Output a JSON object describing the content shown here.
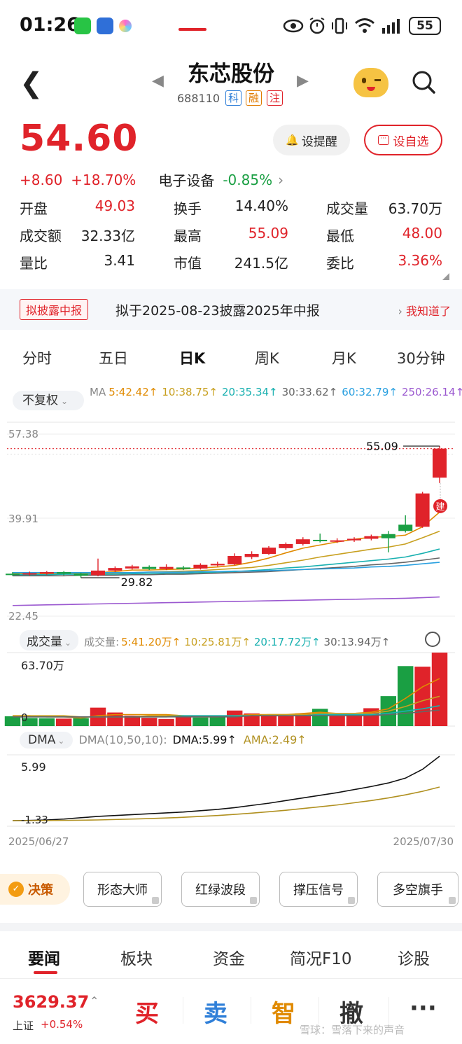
{
  "status": {
    "time": "01:26",
    "battery": "55"
  },
  "header": {
    "name": "东芯股份",
    "code": "688110",
    "tags": [
      {
        "label": "科",
        "color": "#2f7fd8"
      },
      {
        "label": "融",
        "color": "#e07b00"
      },
      {
        "label": "注",
        "color": "#e0232a"
      }
    ]
  },
  "quote": {
    "price": "54.60",
    "change": "+8.60",
    "change_pct": "+18.70%",
    "sector": "电子设备",
    "sector_pct": "-0.85%",
    "remind_label": "设提醒",
    "watch_label": "设自选",
    "stats": [
      {
        "label": "开盘",
        "value": "49.03",
        "color": "red"
      },
      {
        "label": "换手",
        "value": "14.40%",
        "color": "black"
      },
      {
        "label": "成交量",
        "value": "63.70万",
        "color": "black"
      },
      {
        "label": "成交额",
        "value": "32.33亿",
        "color": "black"
      },
      {
        "label": "最高",
        "value": "55.09",
        "color": "red"
      },
      {
        "label": "最低",
        "value": "48.00",
        "color": "red"
      },
      {
        "label": "量比",
        "value": "3.41",
        "color": "black"
      },
      {
        "label": "市值",
        "value": "241.5亿",
        "color": "black"
      },
      {
        "label": "委比",
        "value": "3.36%",
        "color": "red"
      }
    ]
  },
  "disclosure": {
    "tag": "拟披露中报",
    "text": "拟于2025-08-23披露2025年中报",
    "action": "我知道了"
  },
  "period_tabs": [
    "分时",
    "五日",
    "日K",
    "周K",
    "月K",
    "30分钟"
  ],
  "active_period": "日K",
  "ma": {
    "adjust": "不复权",
    "prefix": "MA",
    "items": [
      {
        "label": "5:42.42↑",
        "color": "#e08a00"
      },
      {
        "label": "10:38.75↑",
        "color": "#c8a020"
      },
      {
        "label": "20:35.34↑",
        "color": "#18b0b0"
      },
      {
        "label": "30:33.62↑",
        "color": "#666666"
      },
      {
        "label": "60:32.79↑",
        "color": "#2aa0e0"
      },
      {
        "label": "250:26.14↑",
        "color": "#9b59d0"
      }
    ]
  },
  "vol_legend": {
    "button": "成交量",
    "prefix": "成交量:",
    "items": [
      {
        "label": "5:41.20万↑",
        "color": "#e08a00"
      },
      {
        "label": "10:25.81万↑",
        "color": "#c8a020"
      },
      {
        "label": "20:17.72万↑",
        "color": "#18b0b0"
      },
      {
        "label": "30:13.94万↑",
        "color": "#666666"
      }
    ]
  },
  "dma_legend": {
    "button": "DMA",
    "params": "DMA(10,50,10):",
    "dma": "DMA:5.99↑",
    "ama": "AMA:2.49↑"
  },
  "chart_data": {
    "type": "candlestick",
    "price_axis": {
      "top": "57.38",
      "mid": "39.91",
      "bottom": "22.45",
      "min": 22.45,
      "max": 57.38
    },
    "high_label": "55.09",
    "low_label": "29.82",
    "build_label": "建",
    "start_date": "2025/06/27",
    "end_date": "2025/07/30",
    "candles": [
      {
        "o": 30.6,
        "c": 30.4,
        "h": 30.9,
        "l": 30.2
      },
      {
        "o": 30.5,
        "c": 30.7,
        "h": 31.0,
        "l": 30.3
      },
      {
        "o": 30.6,
        "c": 30.9,
        "h": 31.1,
        "l": 30.4
      },
      {
        "o": 30.9,
        "c": 30.6,
        "h": 31.1,
        "l": 30.3
      },
      {
        "o": 30.6,
        "c": 30.2,
        "h": 30.8,
        "l": 29.82
      },
      {
        "o": 30.3,
        "c": 31.2,
        "h": 33.5,
        "l": 30.1
      },
      {
        "o": 31.2,
        "c": 31.7,
        "h": 32.0,
        "l": 30.9
      },
      {
        "o": 31.6,
        "c": 32.0,
        "h": 32.3,
        "l": 31.4
      },
      {
        "o": 31.9,
        "c": 31.5,
        "h": 32.2,
        "l": 31.3
      },
      {
        "o": 31.5,
        "c": 31.9,
        "h": 32.4,
        "l": 31.3
      },
      {
        "o": 31.8,
        "c": 31.5,
        "h": 32.1,
        "l": 31.3
      },
      {
        "o": 31.6,
        "c": 32.3,
        "h": 32.6,
        "l": 31.4
      },
      {
        "o": 32.2,
        "c": 32.5,
        "h": 32.9,
        "l": 32.0
      },
      {
        "o": 32.4,
        "c": 34.0,
        "h": 34.5,
        "l": 32.2
      },
      {
        "o": 33.8,
        "c": 34.4,
        "h": 34.9,
        "l": 33.4
      },
      {
        "o": 34.4,
        "c": 35.6,
        "h": 35.9,
        "l": 34.2
      },
      {
        "o": 35.5,
        "c": 36.3,
        "h": 36.6,
        "l": 35.2
      },
      {
        "o": 36.3,
        "c": 37.2,
        "h": 37.6,
        "l": 36.0
      },
      {
        "o": 37.1,
        "c": 36.9,
        "h": 38.3,
        "l": 36.6
      },
      {
        "o": 36.8,
        "c": 37.0,
        "h": 37.4,
        "l": 36.5
      },
      {
        "o": 37.0,
        "c": 37.3,
        "h": 37.6,
        "l": 36.7
      },
      {
        "o": 37.3,
        "c": 37.8,
        "h": 38.1,
        "l": 37.0
      },
      {
        "o": 38.2,
        "c": 37.4,
        "h": 38.8,
        "l": 34.7
      },
      {
        "o": 40.0,
        "c": 38.8,
        "h": 41.8,
        "l": 38.5
      },
      {
        "o": 39.6,
        "c": 46.0,
        "h": 46.3,
        "l": 39.4
      },
      {
        "o": 49.03,
        "c": 54.6,
        "h": 55.09,
        "l": 48.0
      }
    ],
    "ma_lines": [
      {
        "name": "MA5",
        "color": "#e08a00",
        "values": [
          30.7,
          30.6,
          30.6,
          30.6,
          30.6,
          30.8,
          31.0,
          31.3,
          31.3,
          31.4,
          31.5,
          31.7,
          31.9,
          32.2,
          32.8,
          33.6,
          34.6,
          35.5,
          36.1,
          36.7,
          37.2,
          37.6,
          37.7,
          38.0,
          39.6,
          42.42
        ]
      },
      {
        "name": "MA10",
        "color": "#c8a020",
        "values": [
          30.6,
          30.6,
          30.6,
          30.6,
          30.6,
          30.6,
          30.7,
          30.8,
          30.9,
          31.0,
          31.1,
          31.2,
          31.4,
          31.6,
          31.8,
          32.2,
          32.7,
          33.2,
          33.8,
          34.3,
          34.8,
          35.3,
          35.7,
          36.3,
          37.5,
          38.75
        ]
      },
      {
        "name": "MA20",
        "color": "#18b0b0",
        "values": [
          30.4,
          30.4,
          30.4,
          30.5,
          30.5,
          30.5,
          30.5,
          30.6,
          30.6,
          30.7,
          30.7,
          30.8,
          30.9,
          31.0,
          31.2,
          31.4,
          31.7,
          31.9,
          32.2,
          32.5,
          32.8,
          33.1,
          33.4,
          33.8,
          34.5,
          35.34
        ]
      },
      {
        "name": "MA30",
        "color": "#666666",
        "values": [
          30.2,
          30.2,
          30.2,
          30.2,
          30.3,
          30.3,
          30.3,
          30.4,
          30.4,
          30.5,
          30.5,
          30.6,
          30.7,
          30.8,
          30.9,
          31.0,
          31.2,
          31.4,
          31.6,
          31.8,
          32.0,
          32.3,
          32.5,
          32.8,
          33.2,
          33.62
        ]
      },
      {
        "name": "MA60",
        "color": "#2aa0e0",
        "values": [
          30.8,
          30.8,
          30.8,
          30.8,
          30.8,
          30.8,
          30.8,
          30.8,
          30.9,
          30.9,
          30.9,
          31.0,
          31.0,
          31.1,
          31.1,
          31.2,
          31.3,
          31.4,
          31.5,
          31.6,
          31.7,
          31.9,
          32.0,
          32.2,
          32.5,
          32.79
        ]
      },
      {
        "name": "MA250",
        "color": "#9b59d0",
        "values": [
          24.5,
          24.56,
          24.62,
          24.68,
          24.74,
          24.8,
          24.86,
          24.92,
          24.98,
          25.04,
          25.1,
          25.16,
          25.22,
          25.28,
          25.34,
          25.4,
          25.46,
          25.52,
          25.58,
          25.64,
          25.7,
          25.76,
          25.82,
          25.88,
          26.0,
          26.14
        ]
      }
    ],
    "volume": {
      "max_label": "63.70万",
      "zero_label": "0",
      "values": [
        8.5,
        7.0,
        6.8,
        6.5,
        6.9,
        16.0,
        11.8,
        9.0,
        7.2,
        6.2,
        7.8,
        7.5,
        8.0,
        13.5,
        11.0,
        9.5,
        8.5,
        11.0,
        15.0,
        9.5,
        10.0,
        15.5,
        26.0,
        52.0,
        51.5,
        63.7
      ],
      "up": [
        false,
        false,
        false,
        true,
        false,
        true,
        true,
        true,
        true,
        true,
        true,
        false,
        false,
        true,
        true,
        true,
        true,
        true,
        false,
        true,
        true,
        true,
        false,
        false,
        true,
        true
      ],
      "ma_lines": [
        {
          "color": "#e08a00",
          "values": [
            9,
            9,
            8,
            8,
            7,
            9,
            10,
            10,
            10,
            10,
            9,
            8,
            8,
            9,
            10,
            10,
            10,
            11,
            12,
            11,
            11,
            12,
            15,
            24,
            34,
            41.2
          ]
        },
        {
          "color": "#c8a020",
          "values": [
            9,
            9,
            9,
            9,
            8,
            8,
            8,
            8,
            9,
            9,
            9,
            9,
            9,
            9,
            9,
            10,
            10,
            10,
            11,
            11,
            11,
            11,
            13,
            17,
            22,
            25.81
          ]
        },
        {
          "color": "#18b0b0",
          "values": [
            8,
            8,
            8,
            8,
            8,
            8,
            8,
            8,
            8,
            8,
            9,
            9,
            9,
            9,
            9,
            9,
            9,
            9,
            10,
            10,
            10,
            10,
            11,
            13,
            15,
            17.72
          ]
        },
        {
          "color": "#666666",
          "values": [
            8,
            8,
            8,
            8,
            8,
            8,
            8,
            8,
            8,
            8,
            8,
            8,
            8,
            8,
            9,
            9,
            9,
            9,
            9,
            9,
            9,
            9,
            10,
            11,
            12.5,
            13.94
          ]
        }
      ]
    },
    "dma": {
      "max_label": "5.99",
      "min_label": "-1.33",
      "dma": [
        -1.33,
        -1.3,
        -1.25,
        -1.15,
        -1.0,
        -0.85,
        -0.75,
        -0.65,
        -0.55,
        -0.45,
        -0.35,
        -0.2,
        -0.05,
        0.15,
        0.4,
        0.65,
        0.95,
        1.25,
        1.55,
        1.85,
        2.2,
        2.55,
        2.95,
        3.5,
        4.5,
        5.99
      ],
      "ama": [
        -1.33,
        -1.33,
        -1.32,
        -1.3,
        -1.28,
        -1.25,
        -1.2,
        -1.15,
        -1.1,
        -1.03,
        -0.95,
        -0.85,
        -0.75,
        -0.62,
        -0.48,
        -0.32,
        -0.15,
        0.05,
        0.25,
        0.45,
        0.7,
        0.95,
        1.25,
        1.6,
        2.0,
        2.49
      ]
    }
  },
  "decision": {
    "badge": "决策",
    "buttons": [
      "形态大师",
      "红绿波段",
      "撑压信号",
      "多空旗手"
    ]
  },
  "bottom_tabs": [
    "要闻",
    "板块",
    "资金",
    "简况F10",
    "诊股"
  ],
  "index": {
    "value": "3629.37",
    "name": "上证",
    "pct": "+0.54%"
  },
  "actions": [
    {
      "label": "买",
      "color": "#e0232a"
    },
    {
      "label": "卖",
      "color": "#2f7fd8"
    },
    {
      "label": "智",
      "color": "#e08a00"
    },
    {
      "label": "撤",
      "color": "#333333"
    },
    {
      "label": "···",
      "color": "#333333"
    }
  ],
  "watermark": "雪球：雪落下来的声音"
}
